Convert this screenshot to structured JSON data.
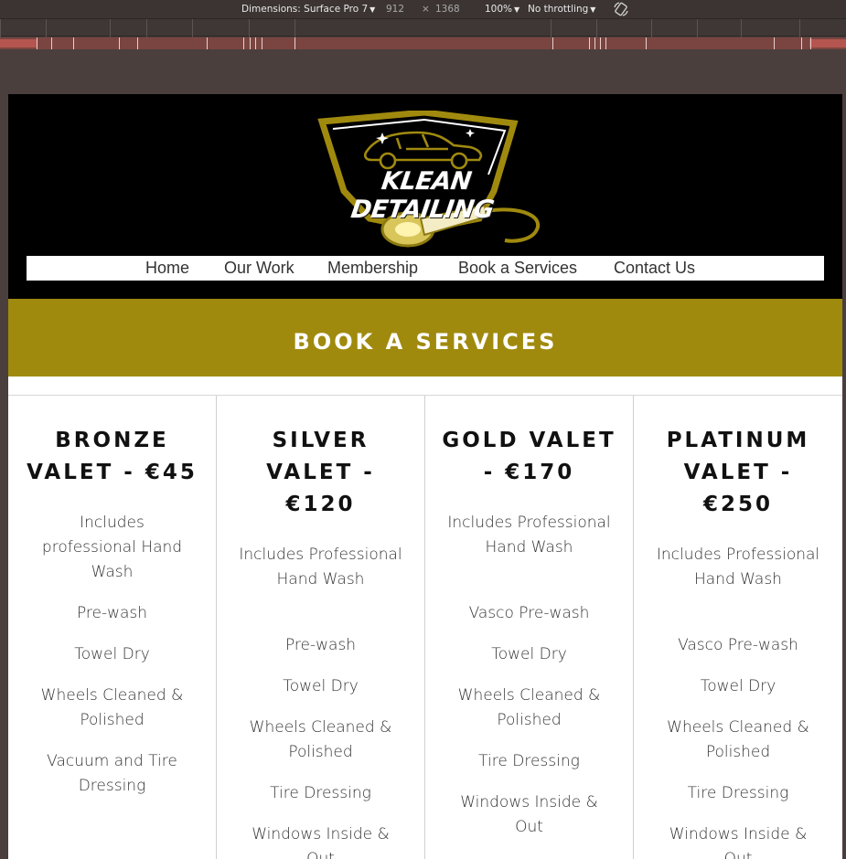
{
  "devtools": {
    "dimensions_label": "Dimensions: Surface Pro 7",
    "width": "912",
    "times": "×",
    "height": "1368",
    "zoom": "100%",
    "throttling": "No throttling"
  },
  "header": {
    "logo_text": "KLEAN DETAILING",
    "brand_color": "#a08a0e"
  },
  "nav": {
    "items": [
      "Home",
      "Our Work",
      "Membership",
      "Book a Services",
      "Contact Us"
    ]
  },
  "banner": {
    "title": "BOOK A SERVICES"
  },
  "packages": [
    {
      "title": "BRONZE VALET - €45",
      "features": [
        "Includes professional Hand Wash",
        "Pre-wash",
        "Towel Dry",
        "Wheels Cleaned & Polished",
        "Vacuum and Tire Dressing"
      ]
    },
    {
      "title": "SILVER VALET - €120",
      "features": [
        "Includes Professional Hand Wash",
        "Pre-wash",
        "Towel Dry",
        "Wheels Cleaned & Polished",
        "Tire Dressing",
        "Windows Inside & Out"
      ]
    },
    {
      "title": "GOLD VALET - €170",
      "features": [
        "Includes Professional Hand Wash",
        "Vasco Pre-wash",
        "Towel Dry",
        "Wheels Cleaned & Polished",
        "Tire Dressing",
        "Windows Inside & Out"
      ]
    },
    {
      "title": "PLATINUM VALET - €250",
      "features": [
        "Includes Professional Hand Wash",
        "Vasco Pre-wash",
        "Towel Dry",
        "Wheels Cleaned & Polished",
        "Tire Dressing",
        "Windows Inside & Out"
      ]
    }
  ]
}
